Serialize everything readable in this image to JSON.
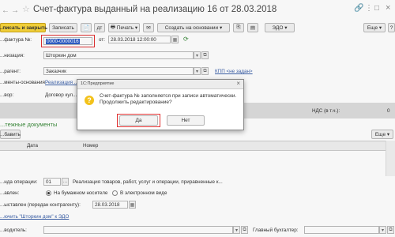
{
  "window": {
    "title": "Счет-фактура выданный на реализацию 16 от 28.03.2018"
  },
  "toolbar": {
    "post_close": "...писать и закрыть",
    "save": "Записать",
    "print": "Печать",
    "create_basis": "Создать на основании",
    "edo": "ЭДО",
    "more": "Еще",
    "help": "?"
  },
  "form": {
    "number_label": "...фактура №:",
    "number_value": "0000-0000016",
    "from_label": "от:",
    "date_value": "28.03.2018 12:00:00",
    "org_label": "...низация:",
    "org_value": "Шторкин дом",
    "counterparty_label": "...рагент:",
    "counterparty_value": "Заказчик",
    "kpp_link": "КПП <не задан>",
    "basis_label": "...менты-основания:",
    "basis_link": "Реализация ...",
    "contract_label": "...вор:",
    "contract_value": "Договор кул...",
    "vat_label": "НДС (в т.ч.):",
    "vat_value": "0"
  },
  "docs": {
    "title": "...тежные документы",
    "add_button": "...бавить",
    "col_date": "Дата",
    "col_number": "Номер"
  },
  "more2": "Еще",
  "bottom": {
    "op_code_label": "...нда операции:",
    "op_code_value": "01",
    "op_code_desc": "Реализация товаров, работ, услуг и операции, приравненные к...",
    "compiled_label": "...авлен:",
    "paper": "На бумажном носителе",
    "electronic": "В электронном виде",
    "issued_label": "...ыставлен (передан контрагенту):",
    "issued_date": "28.03.2018",
    "edo_link": "...ючить \"Шторкин дом\" к ЭДО",
    "head_label": "...водитель:",
    "chief_acc_label": "Главный бухгалтер:"
  },
  "dialog": {
    "title": "1С:Предприятие",
    "message_line1": "Счет-фактура № заполняется при записи автоматически.",
    "message_line2": "Продолжить редактирование?",
    "yes": "Да",
    "no": "Нет"
  },
  "colors": {
    "accent_yellow": "#f8d53b",
    "highlight_red": "#e03030",
    "selection_blue": "#2f5fc8"
  }
}
